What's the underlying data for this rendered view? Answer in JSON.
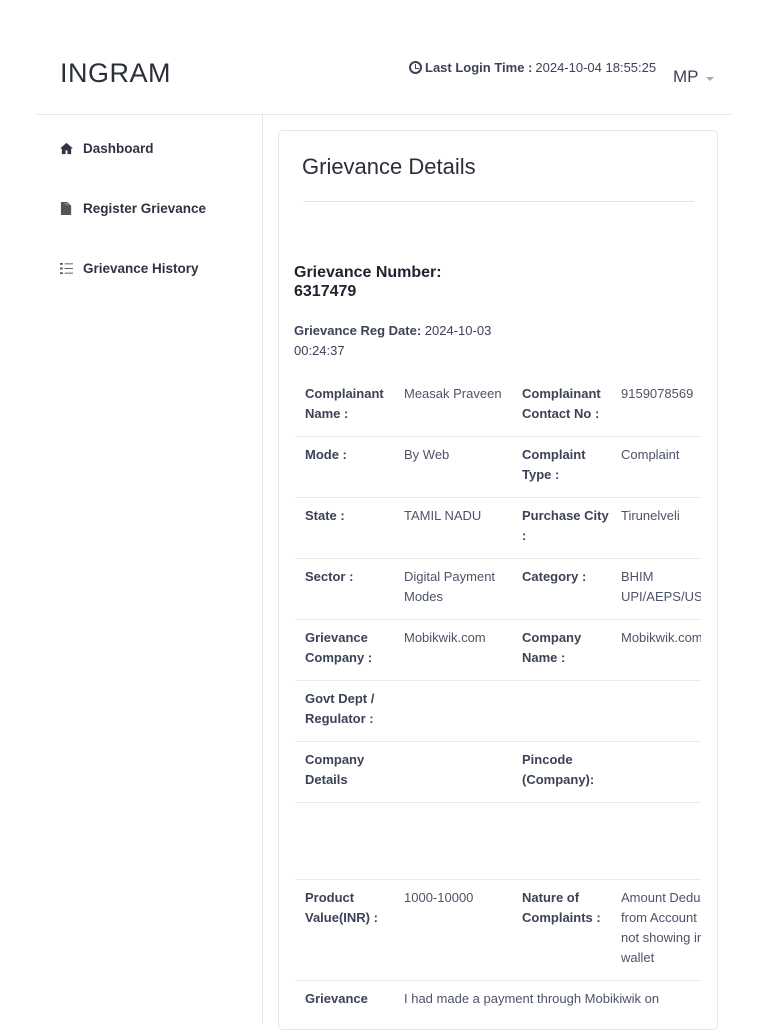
{
  "header": {
    "brand": "INGRAM",
    "last_login_label": "Last Login Time :",
    "last_login_value": "2024-10-04 18:55:25",
    "user_initials": "MP"
  },
  "sidebar": {
    "items": [
      {
        "label": "Dashboard",
        "icon": "home-icon"
      },
      {
        "label": "Register Grievance",
        "icon": "file-icon"
      },
      {
        "label": "Grievance History",
        "icon": "list-icon"
      }
    ]
  },
  "main": {
    "title": "Grievance Details",
    "grievance_number_label": "Grievance Number:",
    "grievance_number": "6317479",
    "reg_date_label": "Grievance Reg Date:",
    "reg_date": "2024-10-03 00:24:37",
    "rows": [
      {
        "l1": "Complainant Name :",
        "v1": "Measak Praveen",
        "l2": "Complainant Contact No :",
        "v2": "9159078569"
      },
      {
        "l1": "Mode :",
        "v1": "By Web",
        "l2": "Complaint Type :",
        "v2": "Complaint"
      },
      {
        "l1": "State :",
        "v1": "TAMIL NADU",
        "l2": "Purchase City :",
        "v2": "Tirunelveli"
      },
      {
        "l1": "Sector :",
        "v1": "Digital Payment Modes",
        "l2": "Category :",
        "v2": "BHIM UPI/AEPS/USSD"
      },
      {
        "l1": "Grievance Company :",
        "v1": "Mobikwik.com",
        "l2": "Company Name :",
        "v2": "Mobikwik.com"
      },
      {
        "l1": "Govt Dept / Regulator :",
        "v1": "",
        "l2": "",
        "v2": ""
      },
      {
        "l1": "Company Details",
        "v1": "",
        "l2": "Pincode (Company):",
        "v2": ""
      },
      {
        "l1": "Product Value(INR) :",
        "v1": "1000-10000",
        "l2": "Nature of Complaints :",
        "v2": "Amount Deducted from Account but not showing in wallet"
      }
    ],
    "description_label": "Grievance",
    "description_value": "I had made a payment through Mobikiwik on"
  }
}
